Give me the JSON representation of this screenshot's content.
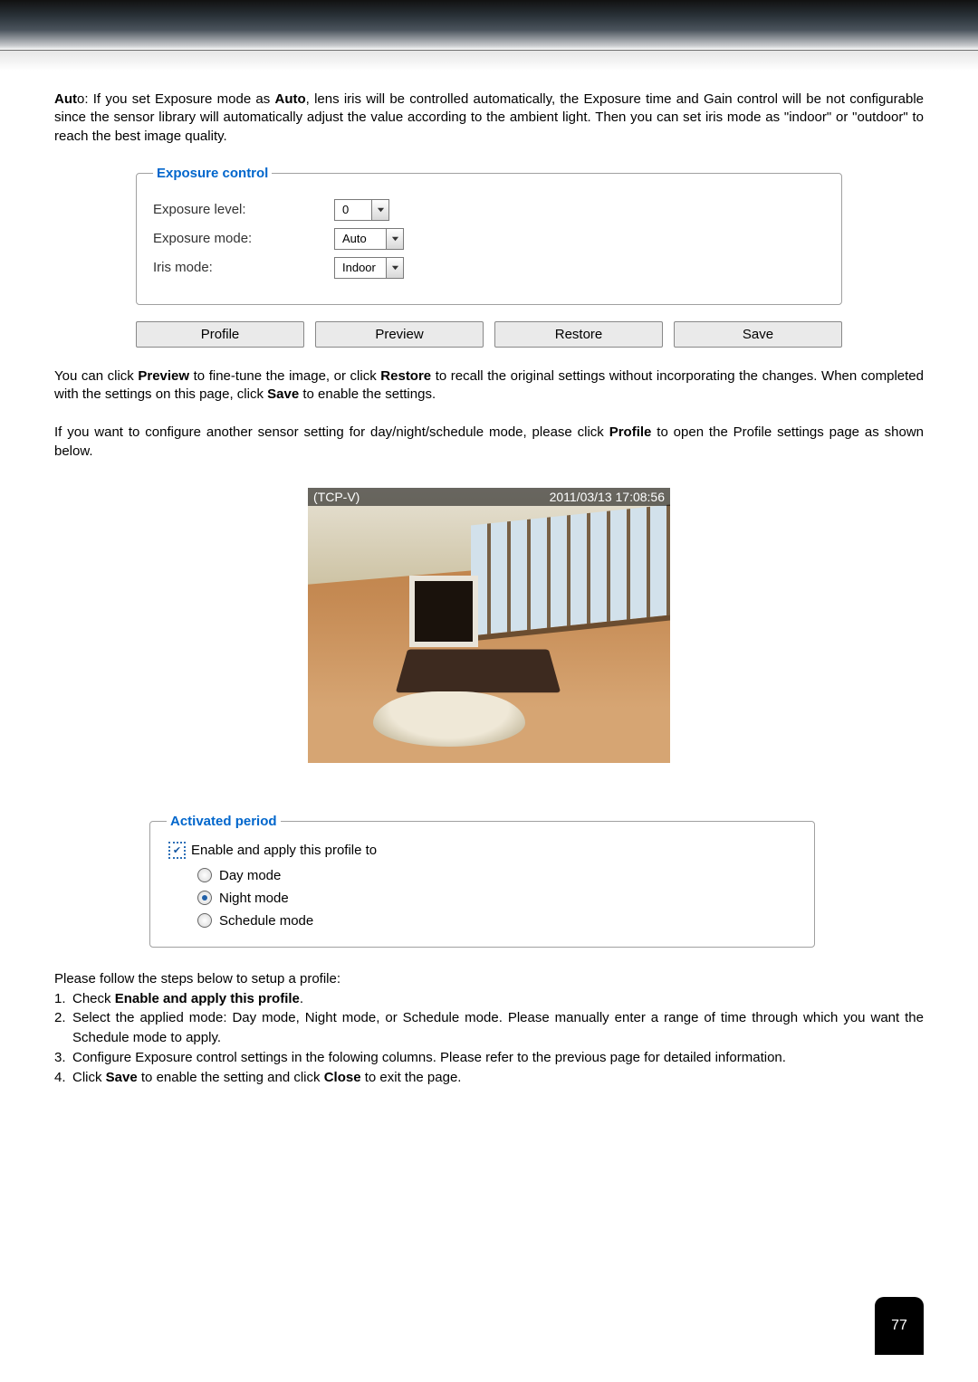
{
  "para1_prefix_bold": "Aut",
  "para1_rest": "o: If you set Exposure mode as ",
  "para1_bold2": "Auto",
  "para1_tail": ", lens iris will be controlled automatically, the Exposure time and Gain control will be not configurable since the sensor library will automatically adjust the value according to the ambient light. Then you can set iris mode as \"indoor\" or \"outdoor\" to reach the best image quality.",
  "exposure": {
    "legend": "Exposure control",
    "labels": {
      "level": "Exposure level:",
      "mode": "Exposure mode:",
      "iris": "Iris mode:"
    },
    "values": {
      "level": "0",
      "mode": "Auto",
      "iris": "Indoor"
    }
  },
  "buttons": {
    "profile": "Profile",
    "preview": "Preview",
    "restore": "Restore",
    "save": "Save"
  },
  "para2_a": "You can click ",
  "para2_b": "Preview",
  "para2_c": " to fine-tune the image, or click ",
  "para2_d": "Restore",
  "para2_e": " to recall the original settings without incorporating the changes. When completed with the settings on this page, click ",
  "para2_f": "Save",
  "para2_g": " to enable the settings.",
  "para3_a": "If you want to configure another sensor setting for day/night/schedule mode, please click ",
  "para3_b": "Profile",
  "para3_c": " to open the Profile settings page as shown below.",
  "camera": {
    "label": "(TCP-V)",
    "timestamp": "2011/03/13  17:08:56"
  },
  "activated": {
    "legend": "Activated period",
    "enable_label": "Enable and apply this profile to",
    "checked": true,
    "options": {
      "day": "Day mode",
      "night": "Night mode",
      "schedule": "Schedule mode"
    },
    "selected": "night"
  },
  "steps_intro": "Please follow the steps below to setup a profile:",
  "steps": {
    "n1": "1.",
    "t1a": "Check ",
    "t1b": "Enable and apply this profile",
    "t1c": ".",
    "n2": "2.",
    "t2": "Select the applied mode: Day mode, Night mode, or Schedule mode. Please manually enter a range of time through which you want the Schedule mode to apply.",
    "n3": "3.",
    "t3": "Configure Exposure control settings in the folowing columns. Please refer to the previous page for detailed information.",
    "n4": "4.",
    "t4a": "Click ",
    "t4b": "Save",
    "t4c": " to enable the setting and click ",
    "t4d": "Close",
    "t4e": " to exit the page."
  },
  "page_number": "77"
}
